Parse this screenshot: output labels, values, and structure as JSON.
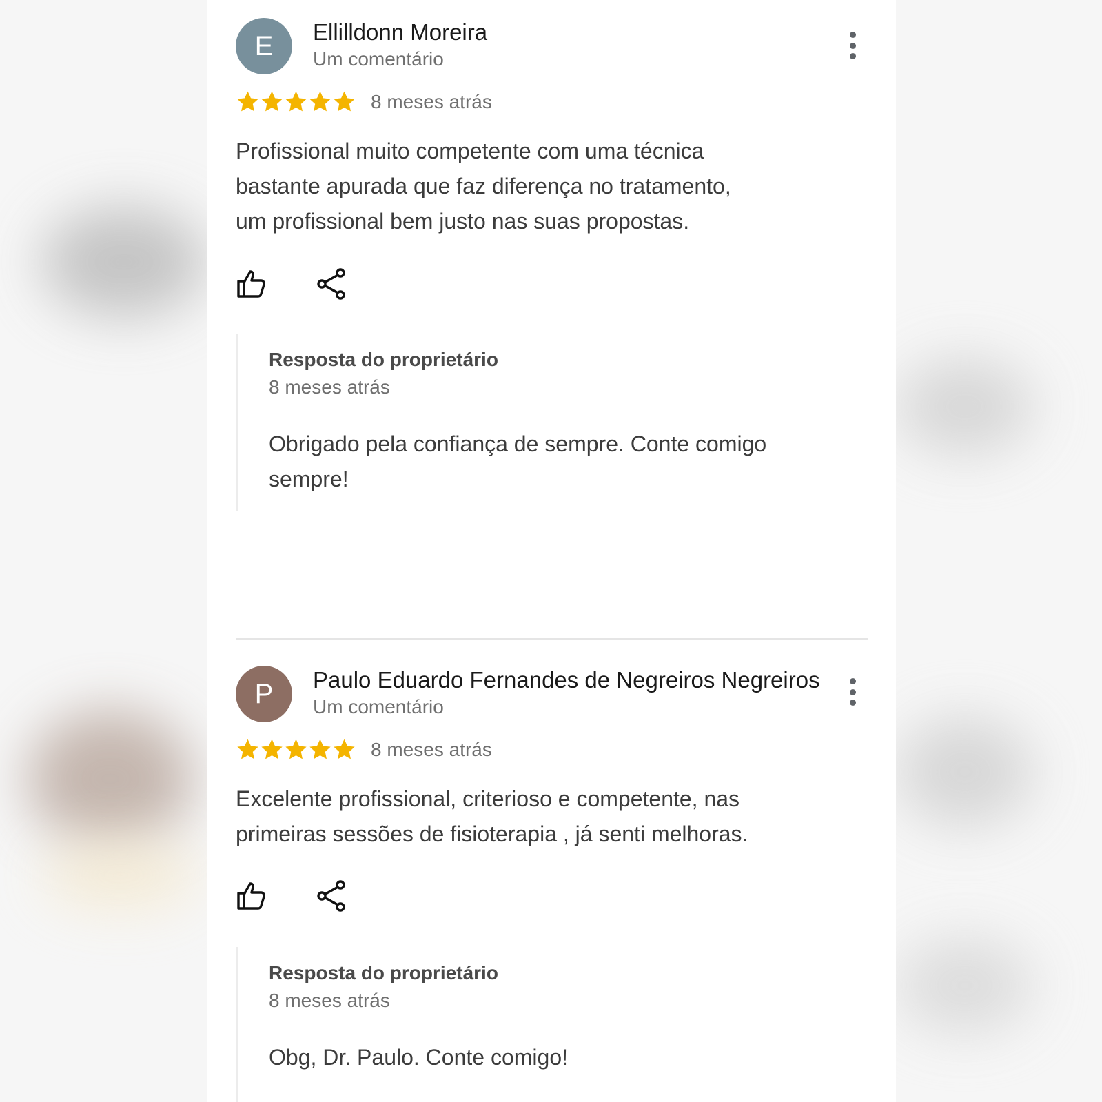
{
  "colors": {
    "star": "#f4b400",
    "avatar_e": "#78909c",
    "avatar_p": "#8d6e63"
  },
  "reviews": [
    {
      "avatar_letter": "E",
      "author": "Ellilldonn Moreira",
      "subtitle": "Um comentário",
      "rating": 5,
      "date": "8 meses atrás",
      "text_lines": [
        "Profissional muito competente com uma técnica",
        "bastante apurada que faz diferença no tratamento,",
        "um profissional bem justo nas suas propostas."
      ],
      "reply": {
        "title": "Resposta do proprietário",
        "date": "8 meses atrás",
        "text_lines": [
          "Obrigado pela confiança de sempre. Conte comigo",
          "sempre!"
        ]
      }
    },
    {
      "avatar_letter": "P",
      "author": "Paulo Eduardo Fernandes de Negreiros Negreiros",
      "subtitle": "Um comentário",
      "rating": 5,
      "date": "8 meses atrás",
      "text_lines": [
        "Excelente profissional, criterioso e competente, nas",
        "primeiras sessões de fisioterapia , já senti melhoras."
      ],
      "reply": {
        "title": "Resposta do proprietário",
        "date": "8 meses atrás",
        "text_lines": [
          "Obg, Dr. Paulo. Conte comigo!"
        ]
      }
    }
  ]
}
